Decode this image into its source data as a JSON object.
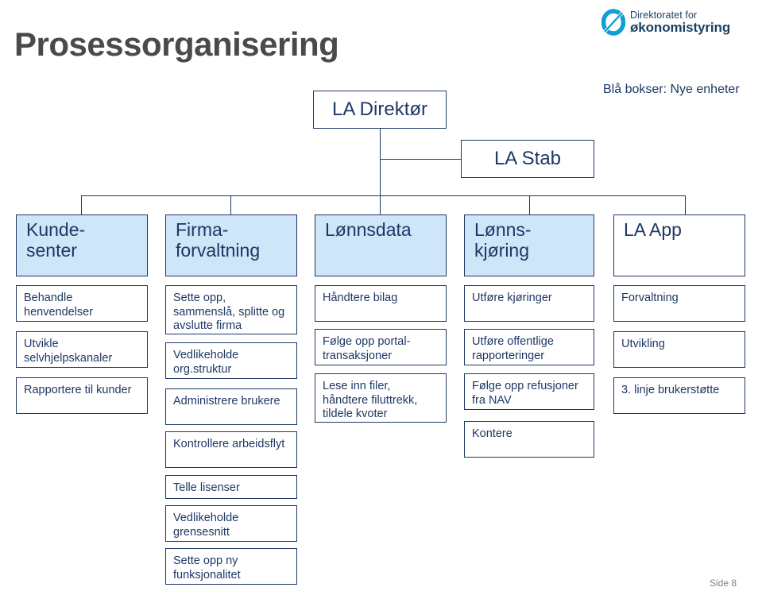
{
  "page": {
    "title": "Prosessorganisering",
    "legend": "Blå bokser: Nye enheter",
    "footer": "Side 8"
  },
  "logo": {
    "line1": "Direktoratet for",
    "line2": "økonomistyring",
    "mark_icon": "slashed-o-icon",
    "color": "#0f9ed5"
  },
  "colors": {
    "title": "#4a4a4a",
    "navy": "#1f3864",
    "new_unit_fill": "#cfe5f8",
    "box_fill": "#ffffff",
    "footer": "#808080"
  },
  "hierarchy": {
    "director": "LA Direktør",
    "staff": "LA Stab"
  },
  "columns": [
    {
      "unit": "Kunde-\nsenter",
      "unit_lines": [
        "Kunde-",
        "senter"
      ],
      "is_new_unit": true,
      "tasks": [
        "Behandle henvendelser",
        "Utvikle selvhjelpskanaler",
        "Rapportere til kunder"
      ]
    },
    {
      "unit": "Firma-\nforvaltning",
      "unit_lines": [
        "Firma-",
        "forvaltning"
      ],
      "is_new_unit": true,
      "tasks": [
        "Sette opp, sammenslå, splitte og avslutte firma",
        "Vedlikeholde org.struktur",
        "Administrere brukere",
        "Kontrollere arbeidsflyt",
        "Telle lisenser",
        "Vedlikeholde grensesnitt",
        "Sette opp ny funksjonalitet"
      ]
    },
    {
      "unit": "Lønnsdata",
      "unit_lines": [
        "Lønnsdata"
      ],
      "is_new_unit": true,
      "tasks": [
        "Håndtere bilag",
        "Følge opp portal-transaksjoner",
        "Lese inn filer, håndtere filuttrekk, tildele kvoter"
      ]
    },
    {
      "unit": "Lønns-\nkjøring",
      "unit_lines": [
        "Lønns-",
        "kjøring"
      ],
      "is_new_unit": true,
      "tasks": [
        "Utføre kjøringer",
        "Utføre offentlige rapporteringer",
        "Følge opp refusjoner fra NAV",
        "Kontere"
      ]
    },
    {
      "unit": "LA App",
      "unit_lines": [
        "LA App"
      ],
      "is_new_unit": false,
      "tasks": [
        "Forvaltning",
        "Utvikling",
        "3. linje brukerstøtte"
      ]
    }
  ]
}
